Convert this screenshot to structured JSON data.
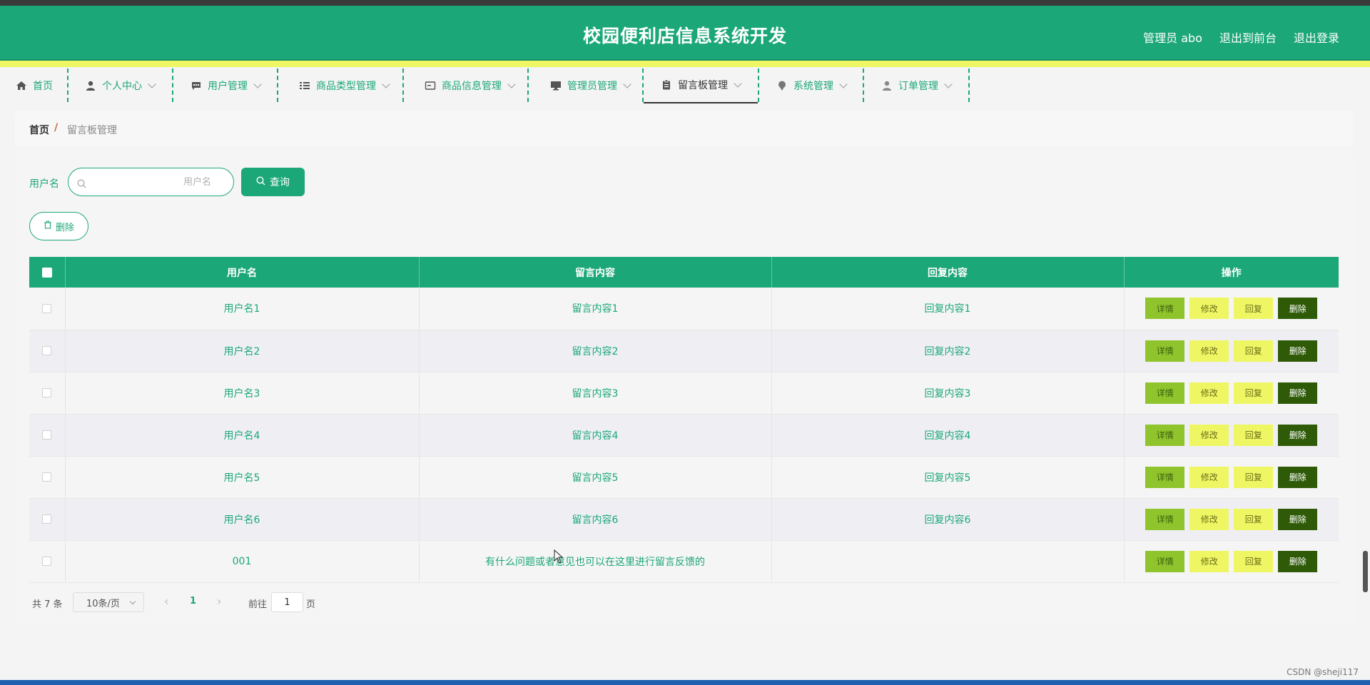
{
  "header": {
    "title": "校园便利店信息系统开发",
    "admin_label": "管理员 abo",
    "front_label": "退出到前台",
    "logout_label": "退出登录"
  },
  "colors": {
    "primary": "#1ca779",
    "accent_yellow": "#eef763",
    "detail": "#8fc42c",
    "danger": "#2f5b08"
  },
  "nav": [
    {
      "label": "首页",
      "icon": "home-icon"
    },
    {
      "label": "个人中心",
      "icon": "user-icon"
    },
    {
      "label": "用户管理",
      "icon": "chat-icon"
    },
    {
      "label": "商品类型管理",
      "icon": "list-icon"
    },
    {
      "label": "商品信息管理",
      "icon": "card-icon"
    },
    {
      "label": "管理员管理",
      "icon": "monitor-icon"
    },
    {
      "label": "留言板管理",
      "icon": "clipboard-icon"
    },
    {
      "label": "系统管理",
      "icon": "pin-icon"
    },
    {
      "label": "订单管理",
      "icon": "person-icon"
    }
  ],
  "breadcrumb": {
    "home": "首页",
    "separator": "/",
    "current": "留言板管理"
  },
  "search": {
    "label": "用户名",
    "placeholder": "用户名",
    "value": "",
    "button": "查询"
  },
  "actions": {
    "delete": "删除"
  },
  "table": {
    "columns": [
      "用户名",
      "留言内容",
      "回复内容",
      "操作"
    ],
    "rows": [
      {
        "username": "用户名1",
        "message": "留言内容1",
        "reply": "回复内容1"
      },
      {
        "username": "用户名2",
        "message": "留言内容2",
        "reply": "回复内容2"
      },
      {
        "username": "用户名3",
        "message": "留言内容3",
        "reply": "回复内容3"
      },
      {
        "username": "用户名4",
        "message": "留言内容4",
        "reply": "回复内容4"
      },
      {
        "username": "用户名5",
        "message": "留言内容5",
        "reply": "回复内容5"
      },
      {
        "username": "用户名6",
        "message": "留言内容6",
        "reply": "回复内容6"
      },
      {
        "username": "001",
        "message": "有什么问题或者意见也可以在这里进行留言反馈的",
        "reply": ""
      }
    ],
    "row_actions": {
      "detail": "详情",
      "edit": "修改",
      "reply": "回复",
      "delete": "删除"
    }
  },
  "pagination": {
    "total": "共 7 条",
    "page_size": "10条/页",
    "current_page": "1",
    "prev": "‹",
    "next": "›",
    "goto_label": "前往",
    "goto_value": "1",
    "page_suffix": "页"
  },
  "watermark": "CSDN @sheji117"
}
